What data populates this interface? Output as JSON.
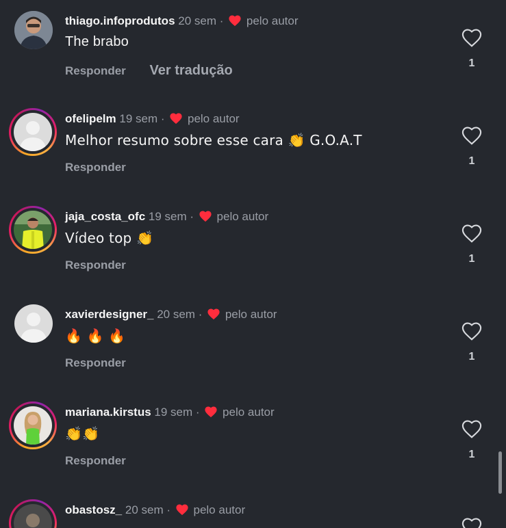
{
  "comments": [
    {
      "username": "thiago.infoprodutos",
      "time": "20 sem",
      "liked_label": "pelo autor",
      "text": "The brabo",
      "reply_label": "Responder",
      "translate_label": "Ver tradução",
      "likes": "1",
      "ring": false
    },
    {
      "username": "ofelipelm",
      "time": "19 sem",
      "liked_label": "pelo autor",
      "text": "Melhor resumo sobre esse cara 👏 G.O.A.T",
      "reply_label": "Responder",
      "likes": "1",
      "ring": true
    },
    {
      "username": "jaja_costa_ofc",
      "time": "19 sem",
      "liked_label": "pelo autor",
      "text": "Vídeo top 👏",
      "reply_label": "Responder",
      "likes": "1",
      "ring": true
    },
    {
      "username": "xavierdesigner_",
      "time": "20 sem",
      "liked_label": "pelo autor",
      "text": "🔥 🔥 🔥",
      "reply_label": "Responder",
      "likes": "1",
      "ring": false
    },
    {
      "username": "mariana.kirstus",
      "time": "19 sem",
      "liked_label": "pelo autor",
      "text": "👏👏",
      "reply_label": "Responder",
      "likes": "1",
      "ring": true
    },
    {
      "username": "obastosz_",
      "time": "20 sem",
      "liked_label": "pelo autor",
      "ring": true
    }
  ],
  "separator": "·",
  "icons": {
    "like": "heart-outline-icon",
    "author_like": "heart-filled-icon"
  },
  "colors": {
    "background": "#25282e",
    "author_heart": "#ff2d3d",
    "muted": "#9a9ea6"
  }
}
